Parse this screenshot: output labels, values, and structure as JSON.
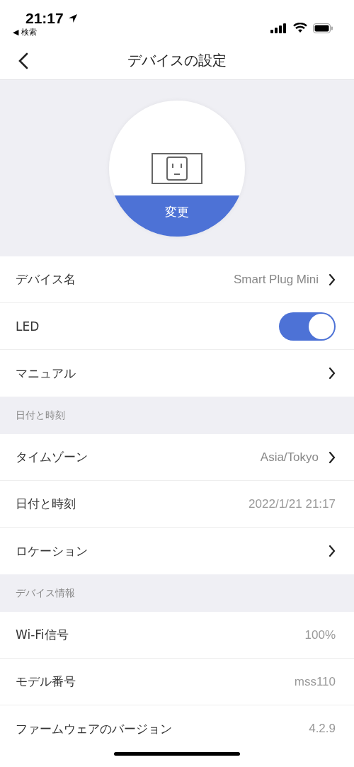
{
  "status_bar": {
    "time": "21:17",
    "back_app": "◀ 検索"
  },
  "nav": {
    "title": "デバイスの設定"
  },
  "device": {
    "change_label": "変更"
  },
  "sections": [
    {
      "rows": [
        {
          "kind": "link",
          "label": "デバイス名",
          "value": "Smart Plug Mini"
        },
        {
          "kind": "toggle",
          "label": "LED",
          "on": true
        },
        {
          "kind": "link",
          "label": "マニュアル"
        }
      ]
    },
    {
      "header": "日付と時刻",
      "rows": [
        {
          "kind": "link",
          "label": "タイムゾーン",
          "value": "Asia/Tokyo"
        },
        {
          "kind": "value",
          "label": "日付と時刻",
          "value": "2022/1/21 21:17"
        },
        {
          "kind": "link",
          "label": "ロケーション"
        }
      ]
    },
    {
      "header": "デバイス情報",
      "rows": [
        {
          "kind": "value",
          "label": "Wi-Fi信号",
          "value": "100%"
        },
        {
          "kind": "value",
          "label": "モデル番号",
          "value": "mss110"
        },
        {
          "kind": "value",
          "label": "ファームウェアのバージョン",
          "value": "4.2.9"
        }
      ]
    }
  ]
}
